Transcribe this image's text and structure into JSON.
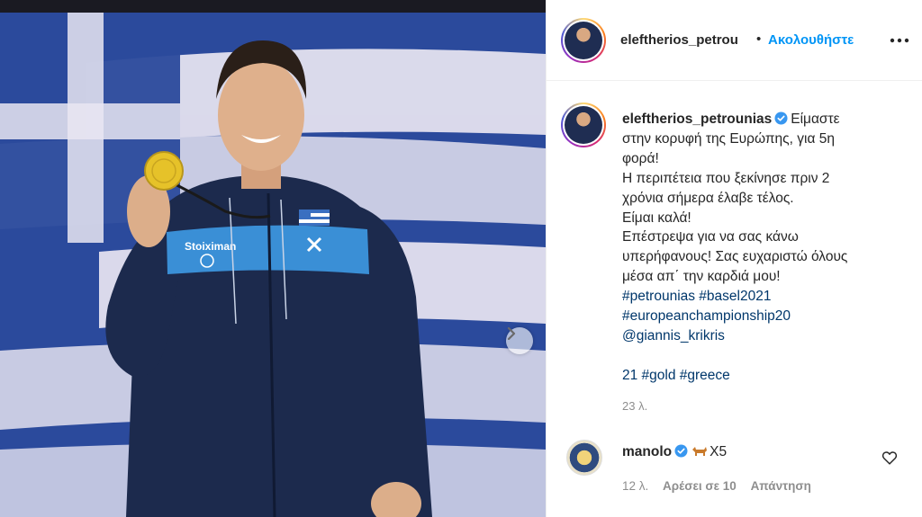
{
  "post_author": {
    "username": "eleftherios_petrou",
    "separator": "•",
    "follow_label": "Ακολουθήστε"
  },
  "caption": {
    "username": "eleftherios_petrounias",
    "lines": [
      "Είμαστε",
      "στην κορυφή της Ευρώπης, για 5η",
      "φορά!",
      "Η περιπέτεια που ξεκίνησε πριν 2",
      "χρόνια σήμερα έλαβε τέλος.",
      "Είμαι καλά!",
      "Επέστρεψα για να σας κάνω",
      "υπερήφανους! Σας ευχαριστώ όλους",
      "μέσα απ΄ την καρδιά μου! ",
      "#petrounias #basel2021",
      "#europeanchampionship20",
      " @giannis_krikris",
      "21 #gold #greece"
    ],
    "time": "23 λ."
  },
  "comment": {
    "username": "manolo",
    "text": "X5 ",
    "time": "12 λ.",
    "likes_label": "Αρέσει σε 10",
    "reply_label": "Απάντηση"
  },
  "photo": {
    "jacket_brand": "Stoiximan",
    "colors": {
      "flag_blue": "#2b4a9c",
      "flag_white": "#e9e6f2",
      "jacket": "#1c2a4d",
      "stripe": "#3a8fd6",
      "gold": "#e6c229"
    }
  },
  "icons": {
    "more": "more-options-icon",
    "verified": "verified-badge-icon",
    "heart": "heart-outline-icon",
    "next": "chevron-right-icon"
  },
  "colors": {
    "accent": "#0095f6",
    "text": "#262626",
    "muted": "#8e8e8e",
    "verified": "#3897f0"
  }
}
